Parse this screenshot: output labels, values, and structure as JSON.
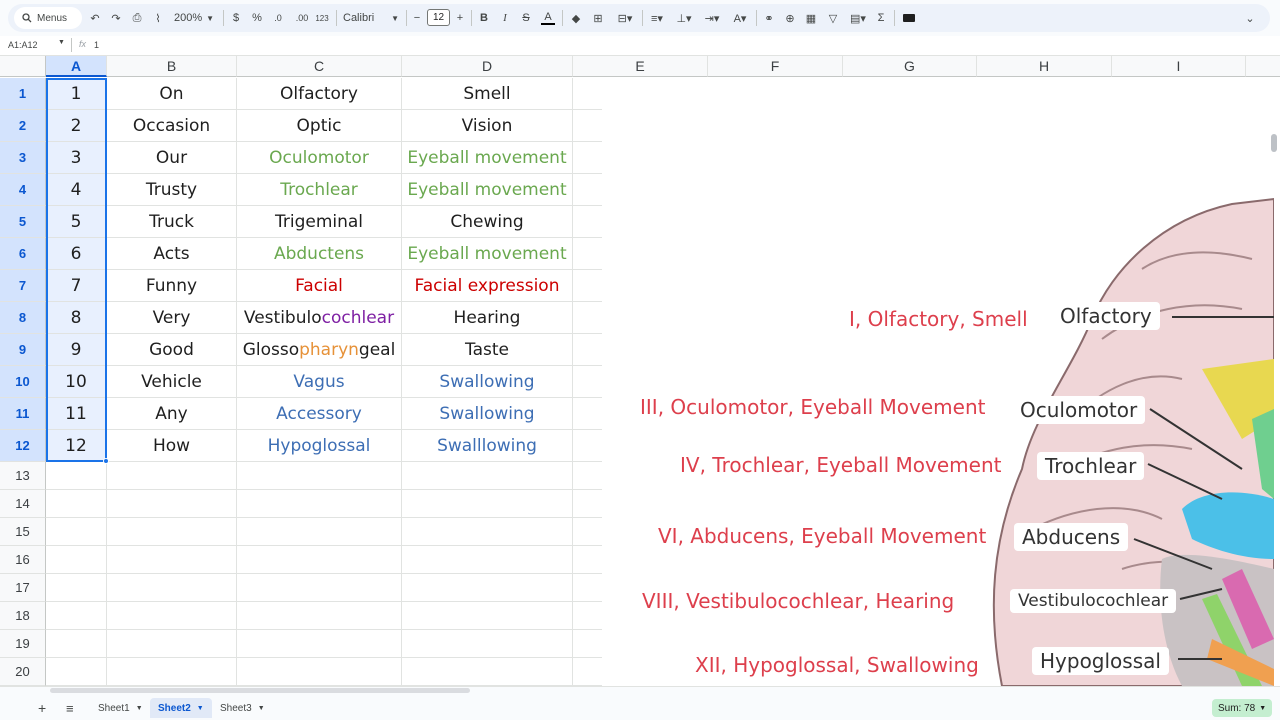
{
  "toolbar": {
    "menus_label": "Menus",
    "zoom": "200%",
    "currency": "$",
    "percent": "%",
    "dec_decrease": ".0",
    "dec_increase": ".00",
    "number_format": "123",
    "font": "Calibri",
    "font_size": "12",
    "bold": "B",
    "italic": "I",
    "strike": "S",
    "text_color": "A",
    "sigma": "Σ"
  },
  "formula_bar": {
    "name_box": "A1:A12",
    "fx": "fx",
    "value": "1"
  },
  "columns": [
    "A",
    "B",
    "C",
    "D",
    "E",
    "F",
    "G",
    "H",
    "I"
  ],
  "rows": [
    {
      "num": "1",
      "a": "1",
      "b": "On",
      "c": "Olfactory",
      "d": "Smell"
    },
    {
      "num": "2",
      "a": "2",
      "b": "Occasion",
      "c": "Optic",
      "d": "Vision"
    },
    {
      "num": "3",
      "a": "3",
      "b": "Our",
      "c": "Oculomotor",
      "d": "Eyeball movement"
    },
    {
      "num": "4",
      "a": "4",
      "b": "Trusty",
      "c": "Trochlear",
      "d": "Eyeball movement"
    },
    {
      "num": "5",
      "a": "5",
      "b": "Truck",
      "c": "Trigeminal",
      "d": "Chewing"
    },
    {
      "num": "6",
      "a": "6",
      "b": "Acts",
      "c": "Abductens",
      "d": "Eyeball movement"
    },
    {
      "num": "7",
      "a": "7",
      "b": "Funny",
      "c": "Facial",
      "d": "Facial expression"
    },
    {
      "num": "8",
      "a": "8",
      "b": "Very",
      "c_parts": [
        "Vestibulo",
        "cochlear"
      ],
      "d": "Hearing"
    },
    {
      "num": "9",
      "a": "9",
      "b": "Good",
      "c_parts": [
        "Glosso",
        "pharyn",
        "geal"
      ],
      "d": "Taste"
    },
    {
      "num": "10",
      "a": "10",
      "b": "Vehicle",
      "c": "Vagus",
      "d": "Swallowing"
    },
    {
      "num": "11",
      "a": "11",
      "b": "Any",
      "c": "Accessory",
      "d": "Swallowing"
    },
    {
      "num": "12",
      "a": "12",
      "b": "How",
      "c": "Hypoglossal",
      "d": "Swalllowing"
    }
  ],
  "empty_rows": [
    "13",
    "14",
    "15",
    "16",
    "17",
    "18",
    "19",
    "20"
  ],
  "image": {
    "annotations": [
      "I, Olfactory, Smell",
      "III, Oculomotor, Eyeball Movement",
      "IV, Trochlear, Eyeball Movement",
      "VI, Abducens, Eyeball Movement",
      "VIII, Vestibulocochlear, Hearing",
      "XII, Hypoglossal, Swallowing"
    ],
    "nerve_labels": [
      "Olfactory",
      "Oculomotor",
      "Trochlear",
      "Abducens",
      "Vestibulocochlear",
      "Hypoglossal"
    ]
  },
  "sheets": [
    "Sheet1",
    "Sheet2",
    "Sheet3"
  ],
  "active_sheet": "Sheet2",
  "sum_label": "Sum: 78",
  "colors": {
    "accent": "#1a73e8",
    "green": "#6aa84f",
    "red": "#cc0000",
    "blue": "#3d6eb4",
    "purple": "#7e1fa3",
    "orange": "#e69138",
    "annotation_red": "#dd3f4c"
  }
}
